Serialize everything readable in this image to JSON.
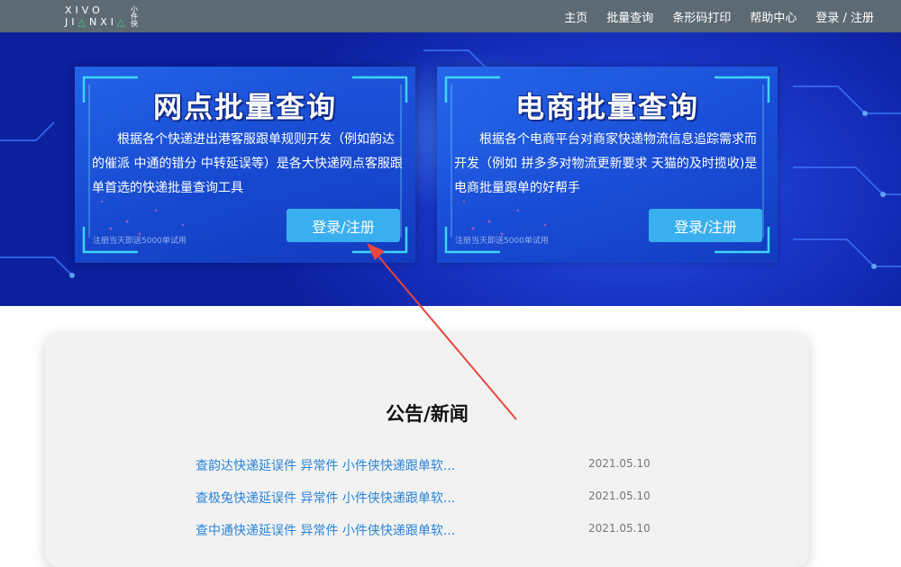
{
  "header": {
    "logo": {
      "row1": "XIVO",
      "row2_a": "JI",
      "row2_b": "△",
      "row2_c": "NXI",
      "row2_d": "△",
      "cn": "小件侠"
    },
    "nav": [
      "主页",
      "批量查询",
      "条形码打印",
      "帮助中心",
      "登录 / 注册"
    ]
  },
  "cards": [
    {
      "title": "网点批量查询",
      "description": "根据各个快递进出港客服跟单规则开发（例如韵达的催派 中通的错分 中转延误等）是各大快递网点客服跟单首选的快递批量查询工具",
      "hint": "注册当天即送5000单试用",
      "button": "登录/注册"
    },
    {
      "title": "电商批量查询",
      "description": "根据各个电商平台对商家快递物流信息追踪需求而开发（例如 拼多多对物流更新要求 天猫的及时揽收)是电商批量跟单的好帮手",
      "hint": "注册当天即送5000单试用",
      "button": "登录/注册"
    }
  ],
  "news": {
    "heading": "公告/新闻",
    "items": [
      {
        "title": "查韵达快递延误件 异常件 小件侠快递跟单软...",
        "date": "2021.05.10"
      },
      {
        "title": "查极兔快递延误件 异常件 小件侠快递跟单软...",
        "date": "2021.05.10"
      },
      {
        "title": "查中通快递延误件 异常件 小件侠快递跟单软...",
        "date": "2021.05.10"
      }
    ]
  },
  "colors": {
    "topbar": "#5d6a73",
    "banner": "#1a37c9",
    "button": "#3aaff0",
    "link": "#2a84d8",
    "annotation_arrow": "#e8453c"
  },
  "icons": [
    "logo-mark",
    "annotation-arrow"
  ]
}
